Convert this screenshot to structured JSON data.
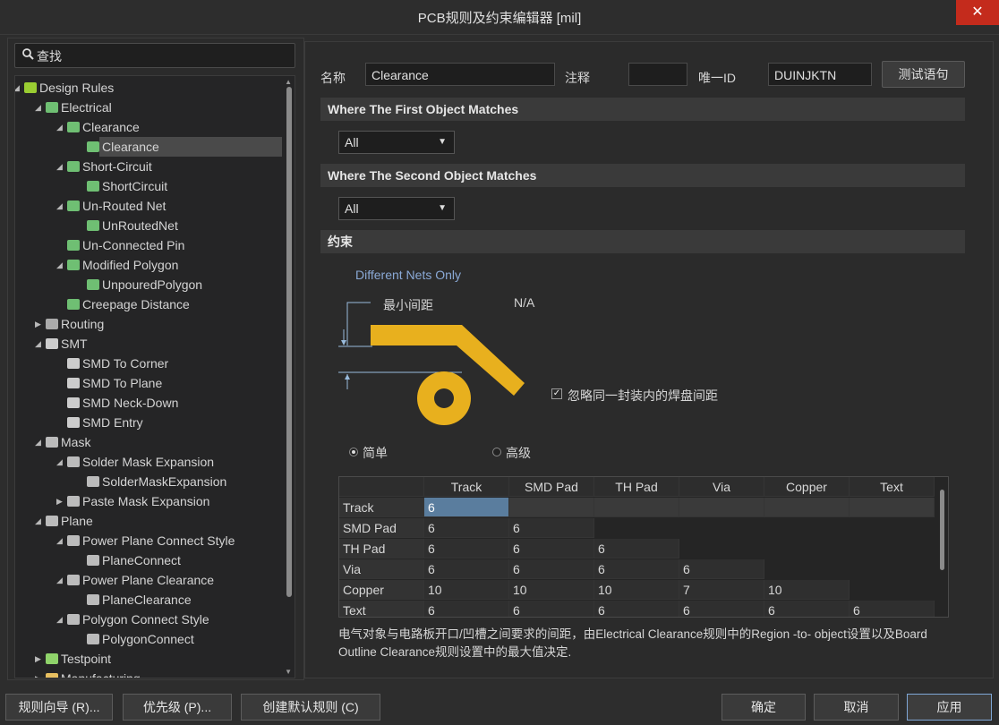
{
  "window": {
    "title": "PCB规则及约束编辑器 [mil]",
    "close_label": "✕"
  },
  "search": {
    "label": "查找",
    "icon": "search-icon"
  },
  "tree": [
    {
      "label": "Design Rules",
      "level": 0,
      "arrow": "expanded",
      "icon": "rules-folder-icon"
    },
    {
      "label": "Electrical",
      "level": 1,
      "arrow": "expanded",
      "icon": "rule-icon"
    },
    {
      "label": "Clearance",
      "level": 2,
      "arrow": "expanded",
      "icon": "rule-icon"
    },
    {
      "label": "Clearance",
      "level": 3,
      "arrow": "none",
      "icon": "rule-icon",
      "selected": true
    },
    {
      "label": "Short-Circuit",
      "level": 2,
      "arrow": "expanded",
      "icon": "rule-icon"
    },
    {
      "label": "ShortCircuit",
      "level": 3,
      "arrow": "none",
      "icon": "rule-icon"
    },
    {
      "label": "Un-Routed Net",
      "level": 2,
      "arrow": "expanded",
      "icon": "rule-icon"
    },
    {
      "label": "UnRoutedNet",
      "level": 3,
      "arrow": "none",
      "icon": "rule-icon"
    },
    {
      "label": "Un-Connected Pin",
      "level": 2,
      "arrow": "none",
      "icon": "rule-icon"
    },
    {
      "label": "Modified Polygon",
      "level": 2,
      "arrow": "expanded",
      "icon": "rule-icon"
    },
    {
      "label": "UnpouredPolygon",
      "level": 3,
      "arrow": "none",
      "icon": "rule-icon"
    },
    {
      "label": "Creepage Distance",
      "level": 2,
      "arrow": "none",
      "icon": "rule-icon"
    },
    {
      "label": "Routing",
      "level": 1,
      "arrow": "collapsed",
      "icon": "routing-icon"
    },
    {
      "label": "SMT",
      "level": 1,
      "arrow": "expanded",
      "icon": "smt-icon"
    },
    {
      "label": "SMD To Corner",
      "level": 2,
      "arrow": "none",
      "icon": "smt-icon"
    },
    {
      "label": "SMD To Plane",
      "level": 2,
      "arrow": "none",
      "icon": "smt-icon"
    },
    {
      "label": "SMD Neck-Down",
      "level": 2,
      "arrow": "none",
      "icon": "smt-icon"
    },
    {
      "label": "SMD Entry",
      "level": 2,
      "arrow": "none",
      "icon": "smt-icon"
    },
    {
      "label": "Mask",
      "level": 1,
      "arrow": "expanded",
      "icon": "mask-icon"
    },
    {
      "label": "Solder Mask Expansion",
      "level": 2,
      "arrow": "expanded",
      "icon": "mask-icon"
    },
    {
      "label": "SolderMaskExpansion",
      "level": 3,
      "arrow": "none",
      "icon": "mask-icon"
    },
    {
      "label": "Paste Mask Expansion",
      "level": 2,
      "arrow": "collapsed",
      "icon": "mask-icon"
    },
    {
      "label": "Plane",
      "level": 1,
      "arrow": "expanded",
      "icon": "plane-icon"
    },
    {
      "label": "Power Plane Connect Style",
      "level": 2,
      "arrow": "expanded",
      "icon": "plane-icon"
    },
    {
      "label": "PlaneConnect",
      "level": 3,
      "arrow": "none",
      "icon": "plane-icon"
    },
    {
      "label": "Power Plane Clearance",
      "level": 2,
      "arrow": "expanded",
      "icon": "plane-icon"
    },
    {
      "label": "PlaneClearance",
      "level": 3,
      "arrow": "none",
      "icon": "plane-icon"
    },
    {
      "label": "Polygon Connect Style",
      "level": 2,
      "arrow": "expanded",
      "icon": "plane-icon"
    },
    {
      "label": "PolygonConnect",
      "level": 3,
      "arrow": "none",
      "icon": "plane-icon"
    },
    {
      "label": "Testpoint",
      "level": 1,
      "arrow": "collapsed",
      "icon": "testpoint-icon"
    },
    {
      "label": "Manufacturing",
      "level": 1,
      "arrow": "collapsed",
      "icon": "folder-icon"
    }
  ],
  "rule": {
    "name_label": "名称",
    "name_value": "Clearance",
    "comment_label": "注释",
    "comment_value": "",
    "uid_label": "唯一ID",
    "uid_value": "DUINJKTN",
    "test_button": "测试语句"
  },
  "sections": {
    "first": "Where The First Object Matches",
    "second": "Where The Second Object Matches",
    "constraints": "约束"
  },
  "first_match": {
    "selected": "All"
  },
  "second_match": {
    "selected": "All"
  },
  "constraints": {
    "net_scope": "Different Nets Only",
    "min_clearance_label": "最小间距",
    "min_clearance_value": "N/A",
    "ignore_pad_checkbox": {
      "label": "忽略同一封装内的焊盘间距",
      "checked": true
    },
    "mode_simple": "简单",
    "mode_advanced": "高级",
    "mode_selected": "simple",
    "track_color": "#e8b01e"
  },
  "grid": {
    "columns": [
      "",
      "Track",
      "SMD Pad",
      "TH Pad",
      "Via",
      "Copper",
      "Text"
    ],
    "rows": [
      {
        "label": "Track",
        "values": [
          "6",
          "",
          "",
          "",
          "",
          ""
        ]
      },
      {
        "label": "SMD Pad",
        "values": [
          "6",
          "6",
          "",
          "",
          "",
          ""
        ]
      },
      {
        "label": "TH Pad",
        "values": [
          "6",
          "6",
          "6",
          "",
          "",
          ""
        ]
      },
      {
        "label": "Via",
        "values": [
          "6",
          "6",
          "6",
          "6",
          "",
          ""
        ]
      },
      {
        "label": "Copper",
        "values": [
          "10",
          "10",
          "10",
          "7",
          "10",
          ""
        ]
      },
      {
        "label": "Text",
        "values": [
          "6",
          "6",
          "6",
          "6",
          "6",
          "6"
        ]
      }
    ]
  },
  "note": {
    "line1": "电气对象与电路板开口/凹槽之间要求的间距，由Electrical Clearance规则中的Region -to- object设置以及Board",
    "line2": "Outline Clearance规则设置中的最大值决定."
  },
  "footer": {
    "wizard": "规则向导 (R)...",
    "priority": "优先级 (P)...",
    "create_default": "创建默认规则 (C)",
    "ok": "确定",
    "cancel": "取消",
    "apply": "应用"
  }
}
